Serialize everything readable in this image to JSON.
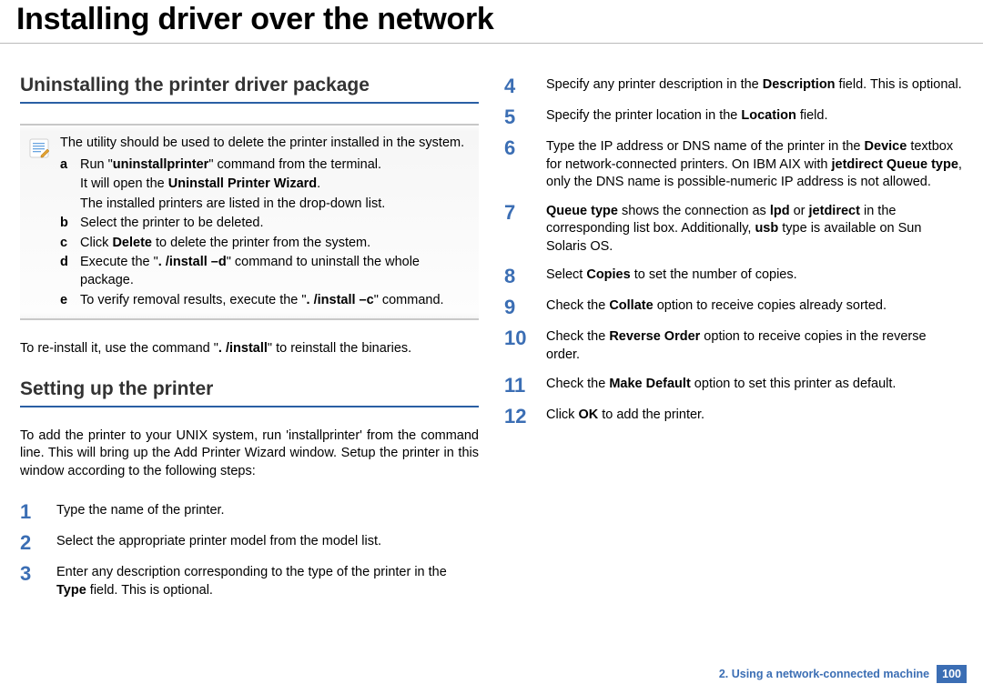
{
  "title": "Installing driver over the network",
  "left": {
    "heading1": "Uninstalling the printer driver package",
    "note_intro": "The utility should be used to delete the printer installed in the system.",
    "sub": [
      {
        "letter": "a",
        "html": "Run \"<b>uninstallprinter</b>\" command from the terminal."
      },
      {
        "letter": "",
        "html": "It will open the <b>Uninstall Printer Wizard</b>."
      },
      {
        "letter": "",
        "html": "The installed printers are listed in the drop-down list."
      },
      {
        "letter": "b",
        "html": "Select the printer to be deleted."
      },
      {
        "letter": "c",
        "html": "Click <b>Delete</b> to delete the printer from the system."
      },
      {
        "letter": "d",
        "html": "Execute the \"<b>. /install –d</b>\" command to uninstall the whole package."
      },
      {
        "letter": "e",
        "html": "To verify removal results, execute the \"<b>. /install –c</b>\" command."
      }
    ],
    "reinstall": "To re-install it, use the command \"<b>. /install</b>\" to reinstall the binaries.",
    "heading2": "Setting up the printer",
    "intro2": "To add the printer to your UNIX system, run 'installprinter' from the command line. This will bring up the Add Printer Wizard window. Setup the printer in this window according to the following steps:",
    "steps": [
      {
        "n": "1",
        "html": "Type the name of the printer."
      },
      {
        "n": "2",
        "html": "Select the appropriate printer model from the model list."
      },
      {
        "n": "3",
        "html": "Enter any description corresponding to the type of the printer in the <b>Type</b> field. This is optional."
      }
    ]
  },
  "right": {
    "steps": [
      {
        "n": "4",
        "html": "Specify any printer description in the <b>Description</b> field. This is optional."
      },
      {
        "n": "5",
        "html": "Specify the printer location in the <b>Location</b> field."
      },
      {
        "n": "6",
        "html": "Type the IP address or DNS name of the printer in the <b>Device</b> textbox for network-connected printers. On IBM AIX with <b>jetdirect Queue type</b>, only the DNS name is possible-numeric IP address is not allowed."
      },
      {
        "n": "7",
        "html": "<b>Queue type</b> shows the connection as <b>lpd</b> or <b>jetdirect</b> in the corresponding list box. Additionally, <b>usb</b> type is available on Sun Solaris OS."
      },
      {
        "n": "8",
        "html": "Select <b>Copies</b> to set the number of copies."
      },
      {
        "n": "9",
        "html": "Check the <b>Collate</b> option to receive copies already sorted."
      },
      {
        "n": "10",
        "html": "Check the <b>Reverse Order</b> option to receive copies in the reverse order."
      },
      {
        "n": "11",
        "html": "Check the <b>Make Default</b> option to set this printer as default."
      },
      {
        "n": "12",
        "html": "Click <b>OK</b> to add the printer."
      }
    ]
  },
  "footer": {
    "chapter": "2.  Using a network-connected machine",
    "page": "100"
  }
}
